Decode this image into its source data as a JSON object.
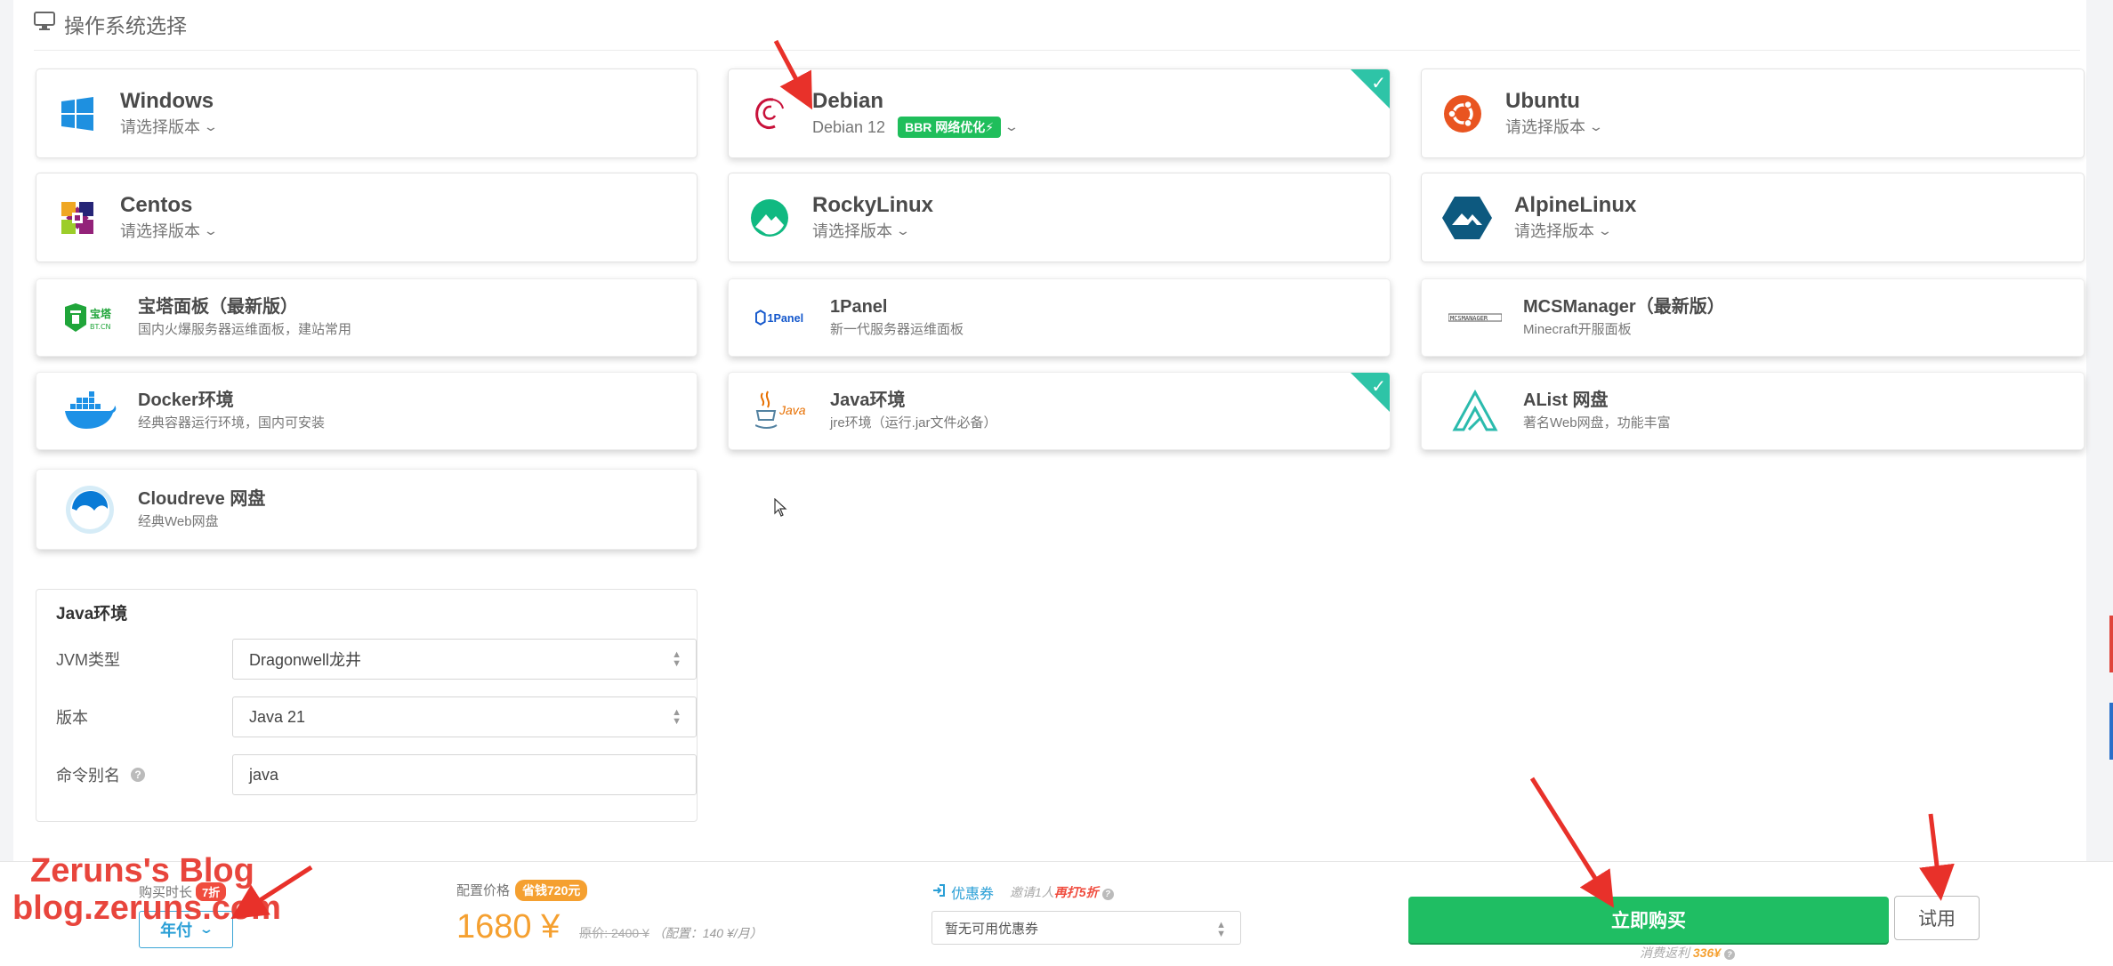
{
  "section": {
    "title": "操作系统选择",
    "icon": "monitor-icon"
  },
  "os_cards": [
    {
      "name": "Windows",
      "sub": "请选择版本",
      "icon": "windows-logo"
    },
    {
      "name": "Debian",
      "sub": "Debian 12",
      "badge": "BBR 网络优化⚡",
      "selected": true,
      "icon": "debian-logo"
    },
    {
      "name": "Ubuntu",
      "sub": "请选择版本",
      "icon": "ubuntu-logo"
    },
    {
      "name": "Centos",
      "sub": "请选择版本",
      "icon": "centos-logo"
    },
    {
      "name": "RockyLinux",
      "sub": "请选择版本",
      "icon": "rockylinux-logo"
    },
    {
      "name": "AlpineLinux",
      "sub": "请选择版本",
      "icon": "alpinelinux-logo"
    }
  ],
  "app_cards": [
    {
      "name": "宝塔面板（最新版）",
      "desc": "国内火爆服务器运维面板，建站常用",
      "icon": "bt-panel-logo",
      "logo_text": "宝塔",
      "logo_sub": "BT.CN"
    },
    {
      "name": "1Panel",
      "desc": "新一代服务器运维面板",
      "icon": "1panel-logo",
      "logo_text": "1Panel"
    },
    {
      "name": "MCSManager（最新版）",
      "desc": "Minecraft开服面板",
      "icon": "mcsmanager-logo",
      "logo_text": "MCSMANAGER"
    },
    {
      "name": "Docker环境",
      "desc": "经典容器运行环境，国内可安装",
      "icon": "docker-logo"
    },
    {
      "name": "Java环境",
      "desc": "jre环境（运行.jar文件必备）",
      "selected": true,
      "icon": "java-logo",
      "logo_text": "Java"
    },
    {
      "name": "AList 网盘",
      "desc": "著名Web网盘，功能丰富",
      "icon": "alist-logo"
    },
    {
      "name": "Cloudreve 网盘",
      "desc": "经典Web网盘",
      "icon": "cloudreve-logo"
    }
  ],
  "java_env": {
    "title": "Java环境",
    "jvm_label": "JVM类型",
    "jvm_value": "Dragonwell龙井",
    "version_label": "版本",
    "version_value": "Java 21",
    "alias_label": "命令别名",
    "alias_value": "java"
  },
  "purchase": {
    "duration_label": "购买时长",
    "discount": "7折",
    "period": "年付",
    "price_label": "配置价格",
    "save_badge": "省钱720元",
    "price": "1680 ¥",
    "original_label": "原价:",
    "original": "2400 ¥",
    "config_note": "（配置：140 ¥/月）",
    "coupon_label": "优惠券",
    "invite_prefix": "邀请1人",
    "invite_highlight": "再打5折",
    "coupon_value": "暂无可用优惠券",
    "buy_label": "立即购买",
    "trial_label": "试用",
    "rebate_prefix": "消费返利",
    "rebate_value": "336¥"
  },
  "watermark": {
    "line1": "Zeruns's Blog",
    "line2": "blog.zeruns.com"
  },
  "colors": {
    "accent_green": "#1fbe63",
    "check_teal": "#2ec4a7",
    "price_orange": "#f5a030",
    "arrow_red": "#e8312a",
    "link_blue": "#2a9fd6"
  }
}
